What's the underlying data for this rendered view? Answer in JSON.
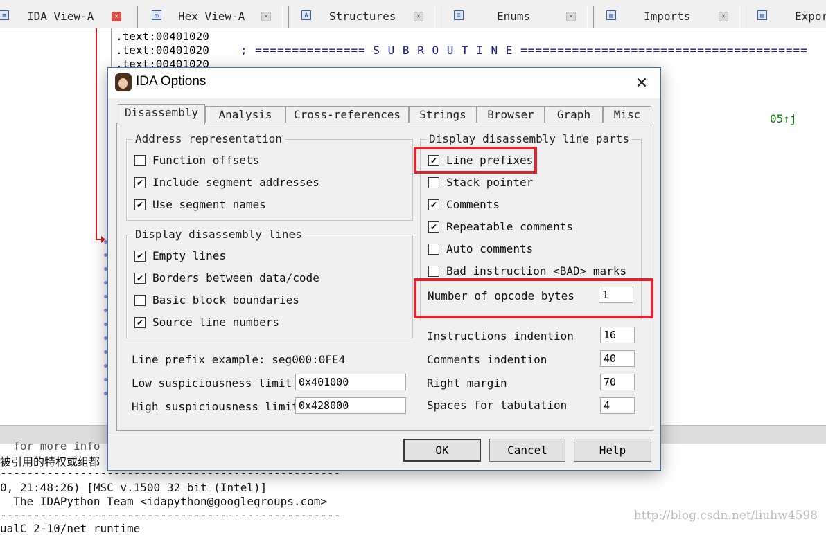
{
  "tabs": [
    {
      "label": "IDA View-A",
      "icon": "ida-view-icon"
    },
    {
      "label": "Hex View-A",
      "icon": "hex-view-icon"
    },
    {
      "label": "Structures",
      "icon": "structures-icon"
    },
    {
      "label": "Enums",
      "icon": "enums-icon"
    },
    {
      "label": "Imports",
      "icon": "imports-icon"
    },
    {
      "label": "Expor",
      "icon": "exports-icon"
    }
  ],
  "code": {
    "lines": [
      ".text:00401020",
      ".text:00401020",
      ".text:00401020"
    ],
    "subroutine_comment": "; =============== S U B R O U T I N E =======================================",
    "xref_fragment": "05↑j"
  },
  "output": {
    "lines": [
      "  for more info",
      "被引用的特权或组都",
      "---------------------------------------------------",
      "0, 21:48:26) [MSC v.1500 32 bit (Intel)]",
      "  The IDAPython Team <idapython@googlegroups.com>",
      "---------------------------------------------------",
      "ualC 2-10/net runtime"
    ],
    "watermark": "http://blog.csdn.net/liuhw4598"
  },
  "dialog": {
    "title": "IDA Options",
    "tabs": [
      "Disassembly",
      "Analysis",
      "Cross-references",
      "Strings",
      "Browser",
      "Graph",
      "Misc"
    ],
    "selected_tab": "Disassembly",
    "address_representation": {
      "title": "Address representation",
      "items": [
        {
          "label": "Function offsets",
          "checked": false
        },
        {
          "label": "Include segment addresses",
          "checked": true
        },
        {
          "label": "Use segment names",
          "checked": true
        }
      ]
    },
    "display_lines": {
      "title": "Display disassembly lines",
      "items": [
        {
          "label": "Empty lines",
          "checked": true
        },
        {
          "label": "Borders between data/code",
          "checked": true
        },
        {
          "label": "Basic block boundaries",
          "checked": false
        },
        {
          "label": "Source line numbers",
          "checked": true
        }
      ]
    },
    "line_parts": {
      "title": "Display disassembly line parts",
      "items": [
        {
          "label": "Line prefixes",
          "checked": true
        },
        {
          "label": "Stack pointer",
          "checked": false
        },
        {
          "label": "Comments",
          "checked": true
        },
        {
          "label": "Repeatable comments",
          "checked": true
        },
        {
          "label": "Auto comments",
          "checked": false
        },
        {
          "label": "Bad instruction <BAD> marks",
          "checked": false
        }
      ],
      "opcode_bytes_label": "Number of opcode bytes",
      "opcode_bytes_value": "1"
    },
    "line_prefix_example": "Line prefix example: seg000:0FE4",
    "low_limit_label": "Low suspiciousness limit",
    "low_limit_value": "0x401000",
    "high_limit_label": "High suspiciousness limit",
    "high_limit_value": "0x428000",
    "indent_fields": [
      {
        "label": "Instructions indention",
        "value": "16"
      },
      {
        "label": "Comments indention",
        "value": "40"
      },
      {
        "label": "Right margin",
        "value": "70"
      },
      {
        "label": "Spaces for tabulation",
        "value": "4"
      }
    ],
    "buttons": {
      "ok": "OK",
      "cancel": "Cancel",
      "help": "Help"
    },
    "check_glyph": "✔",
    "close_glyph": "✕"
  },
  "colors": {
    "highlight": "#e4222d",
    "xref_green": "#0a7a0a",
    "dialog_border": "#3c6fb7"
  }
}
